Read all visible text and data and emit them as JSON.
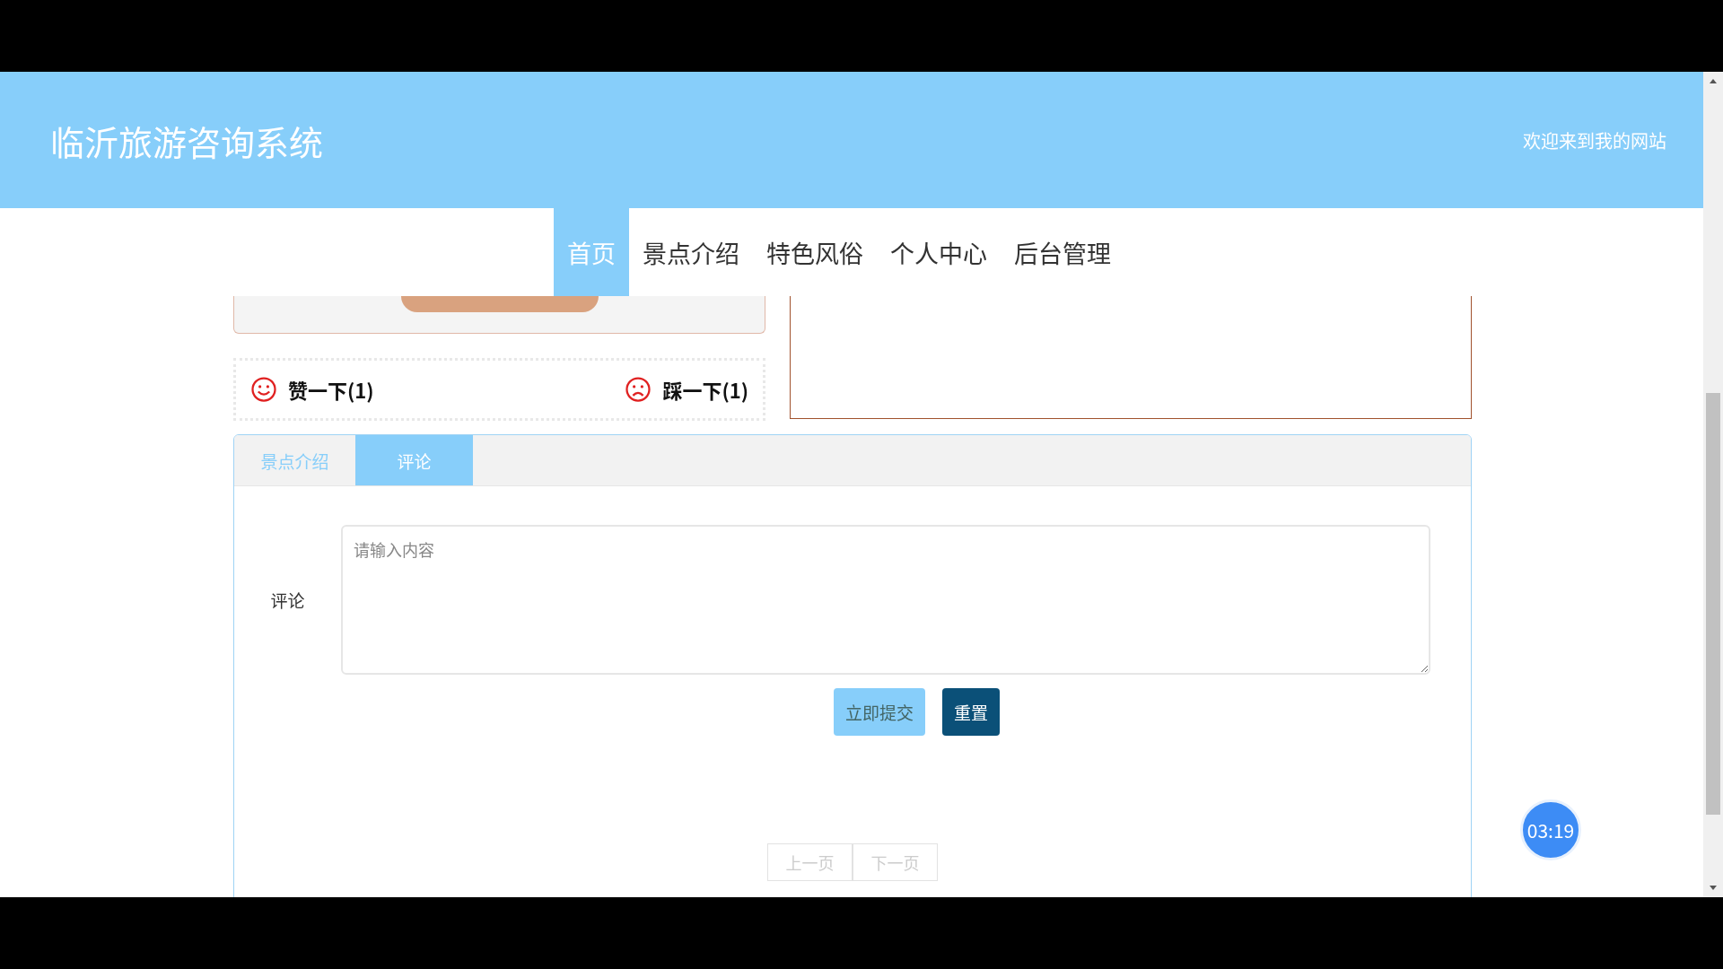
{
  "header": {
    "title": "临沂旅游咨询系统",
    "welcome": "欢迎来到我的网站"
  },
  "nav": [
    {
      "label": "首页",
      "selected": true
    },
    {
      "label": "景点介绍",
      "selected": false
    },
    {
      "label": "特色风俗",
      "selected": false
    },
    {
      "label": "个人中心",
      "selected": false
    },
    {
      "label": "后台管理",
      "selected": false
    }
  ],
  "reactions": [
    {
      "kind": "like",
      "label": "赞一下(1)"
    },
    {
      "kind": "dislike",
      "label": "踩一下(1)"
    }
  ],
  "tabs": [
    {
      "label": "景点介绍",
      "selected": false
    },
    {
      "label": "评论",
      "selected": true
    }
  ],
  "comment_form": {
    "label": "评论",
    "placeholder": "请输入内容",
    "buttons": [
      {
        "kind": "submit",
        "label": "立即提交"
      },
      {
        "kind": "reset",
        "label": "重置"
      }
    ]
  },
  "pagination": [
    {
      "label": "上一页",
      "disabled": true
    },
    {
      "label": "下一页",
      "disabled": true
    }
  ],
  "timer": "03:19"
}
